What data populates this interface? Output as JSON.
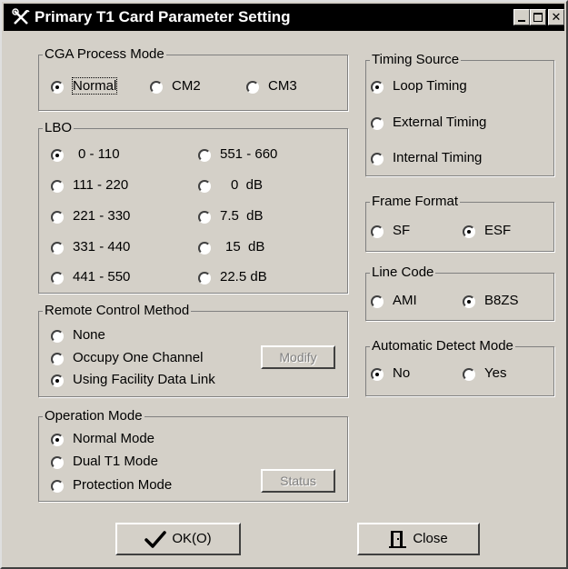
{
  "window": {
    "title": "Primary T1 Card Parameter Setting"
  },
  "cga": {
    "legend": "CGA Process Mode",
    "options": [
      "Normal",
      "CM2",
      "CM3"
    ],
    "selected": "Normal"
  },
  "lbo": {
    "legend": "LBO",
    "options": [
      "0 - 110",
      "111 - 220",
      "221 - 330",
      "331 - 440",
      "441 - 550",
      "551 - 660",
      "0  dB",
      "7.5  dB",
      "15  dB",
      "22.5 dB"
    ],
    "selected": "0 - 110"
  },
  "remote": {
    "legend": "Remote Control Method",
    "options": [
      "None",
      "Occupy One Channel",
      "Using Facility Data Link"
    ],
    "selected": "Using Facility Data Link",
    "modify_label": "Modify"
  },
  "operation": {
    "legend": "Operation Mode",
    "options": [
      "Normal Mode",
      "Dual T1 Mode",
      "Protection Mode"
    ],
    "selected": "Normal Mode",
    "status_label": "Status"
  },
  "timing": {
    "legend": "Timing Source",
    "options": [
      "Loop Timing",
      "External Timing",
      "Internal Timing"
    ],
    "selected": "Loop Timing"
  },
  "frame": {
    "legend": "Frame Format",
    "options": [
      "SF",
      "ESF"
    ],
    "selected": "ESF"
  },
  "linecode": {
    "legend": "Line Code",
    "options": [
      "AMI",
      "B8ZS"
    ],
    "selected": "B8ZS"
  },
  "autodetect": {
    "legend": "Automatic Detect Mode",
    "options": [
      "No",
      "Yes"
    ],
    "selected": "No"
  },
  "buttons": {
    "ok": "OK(O)",
    "close": "Close"
  },
  "icons": {
    "app": "tools-icon",
    "ok": "checkmark-icon",
    "close": "door-icon"
  }
}
